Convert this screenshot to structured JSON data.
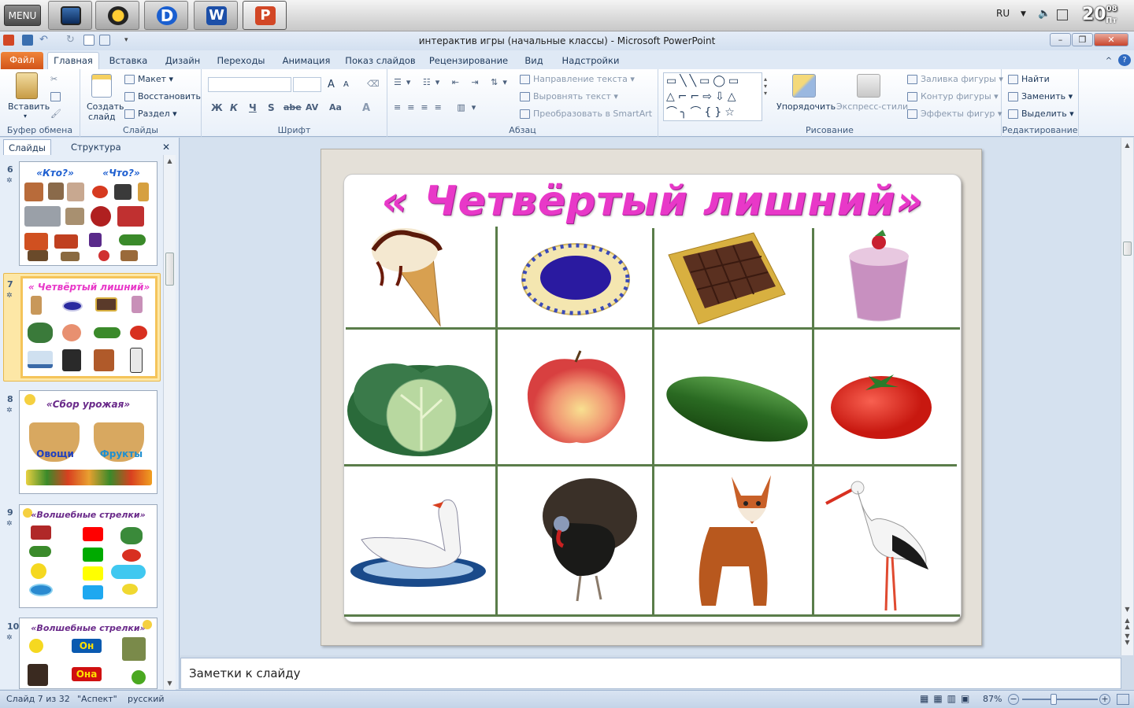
{
  "os_bar": {
    "menu_label": "MENU",
    "language": "RU",
    "clock_time": "20",
    "clock_minutes": "08",
    "clock_day": "Пт"
  },
  "window": {
    "title": "интерактив игры (начальные классы)  -  Microsoft PowerPoint"
  },
  "tabs": [
    "Файл",
    "Главная",
    "Вставка",
    "Дизайн",
    "Переходы",
    "Анимация",
    "Показ слайдов",
    "Рецензирование",
    "Вид",
    "Надстройки"
  ],
  "ribbon": {
    "clipboard": {
      "paste": "Вставить",
      "group": "Буфер обмена"
    },
    "slides": {
      "new_slide_1": "Создать",
      "new_slide_2": "слайд",
      "layout": "Макет",
      "reset": "Восстановить",
      "section": "Раздел",
      "group": "Слайды"
    },
    "font": {
      "group": "Шрифт",
      "bold": "Ж",
      "italic": "К",
      "underline": "Ч",
      "strike": "S",
      "abc": "abe",
      "av": "AV",
      "aa": "Aa",
      "grow": "A",
      "shrink": "A"
    },
    "paragraph": {
      "group": "Абзац",
      "text_direction": "Направление текста",
      "align_text": "Выровнять текст",
      "smartart": "Преобразовать в SmartArt"
    },
    "drawing": {
      "group": "Рисование",
      "arrange": "Упорядочить",
      "quick_styles": "Экспресс-стили",
      "fill": "Заливка фигуры",
      "outline": "Контур фигуры",
      "effects": "Эффекты фигур"
    },
    "editing": {
      "group": "Редактирование",
      "find": "Найти",
      "replace": "Заменить",
      "select": "Выделить"
    }
  },
  "left_pane": {
    "tab_slides": "Слайды",
    "tab_outline": "Структура",
    "thumbnails": [
      {
        "number": "6",
        "title_left": "«Кто?»",
        "title_right": "«Что?»"
      },
      {
        "number": "7",
        "title": "« Четвёртый лишний»"
      },
      {
        "number": "8",
        "title": "«Сбор урожая»",
        "label_left": "Овощи",
        "label_right": "Фрукты"
      },
      {
        "number": "9",
        "title": "«Волшебные стрелки»"
      },
      {
        "number": "10",
        "title": "«Волшебные стрелки»",
        "label_top": "Он",
        "label_bottom": "Она"
      }
    ]
  },
  "slide": {
    "title": "« Четвёртый лишний»",
    "cells": [
      "ice-cream",
      "plate",
      "chocolate",
      "milkshake",
      "cabbage",
      "apple",
      "cucumber",
      "tomato",
      "swan",
      "turkey",
      "fox",
      "stork"
    ]
  },
  "notes": {
    "placeholder": "Заметки к слайду"
  },
  "status": {
    "slide_pos": "Слайд 7 из 32",
    "theme": "\"Аспект\"",
    "lang": "русский",
    "zoom": "87%"
  },
  "colors": {
    "title_magenta": "#e838c8",
    "grid_green": "#5a7d4a",
    "file_tab": "#e06a28",
    "selected_thumb": "#f5c45a"
  }
}
